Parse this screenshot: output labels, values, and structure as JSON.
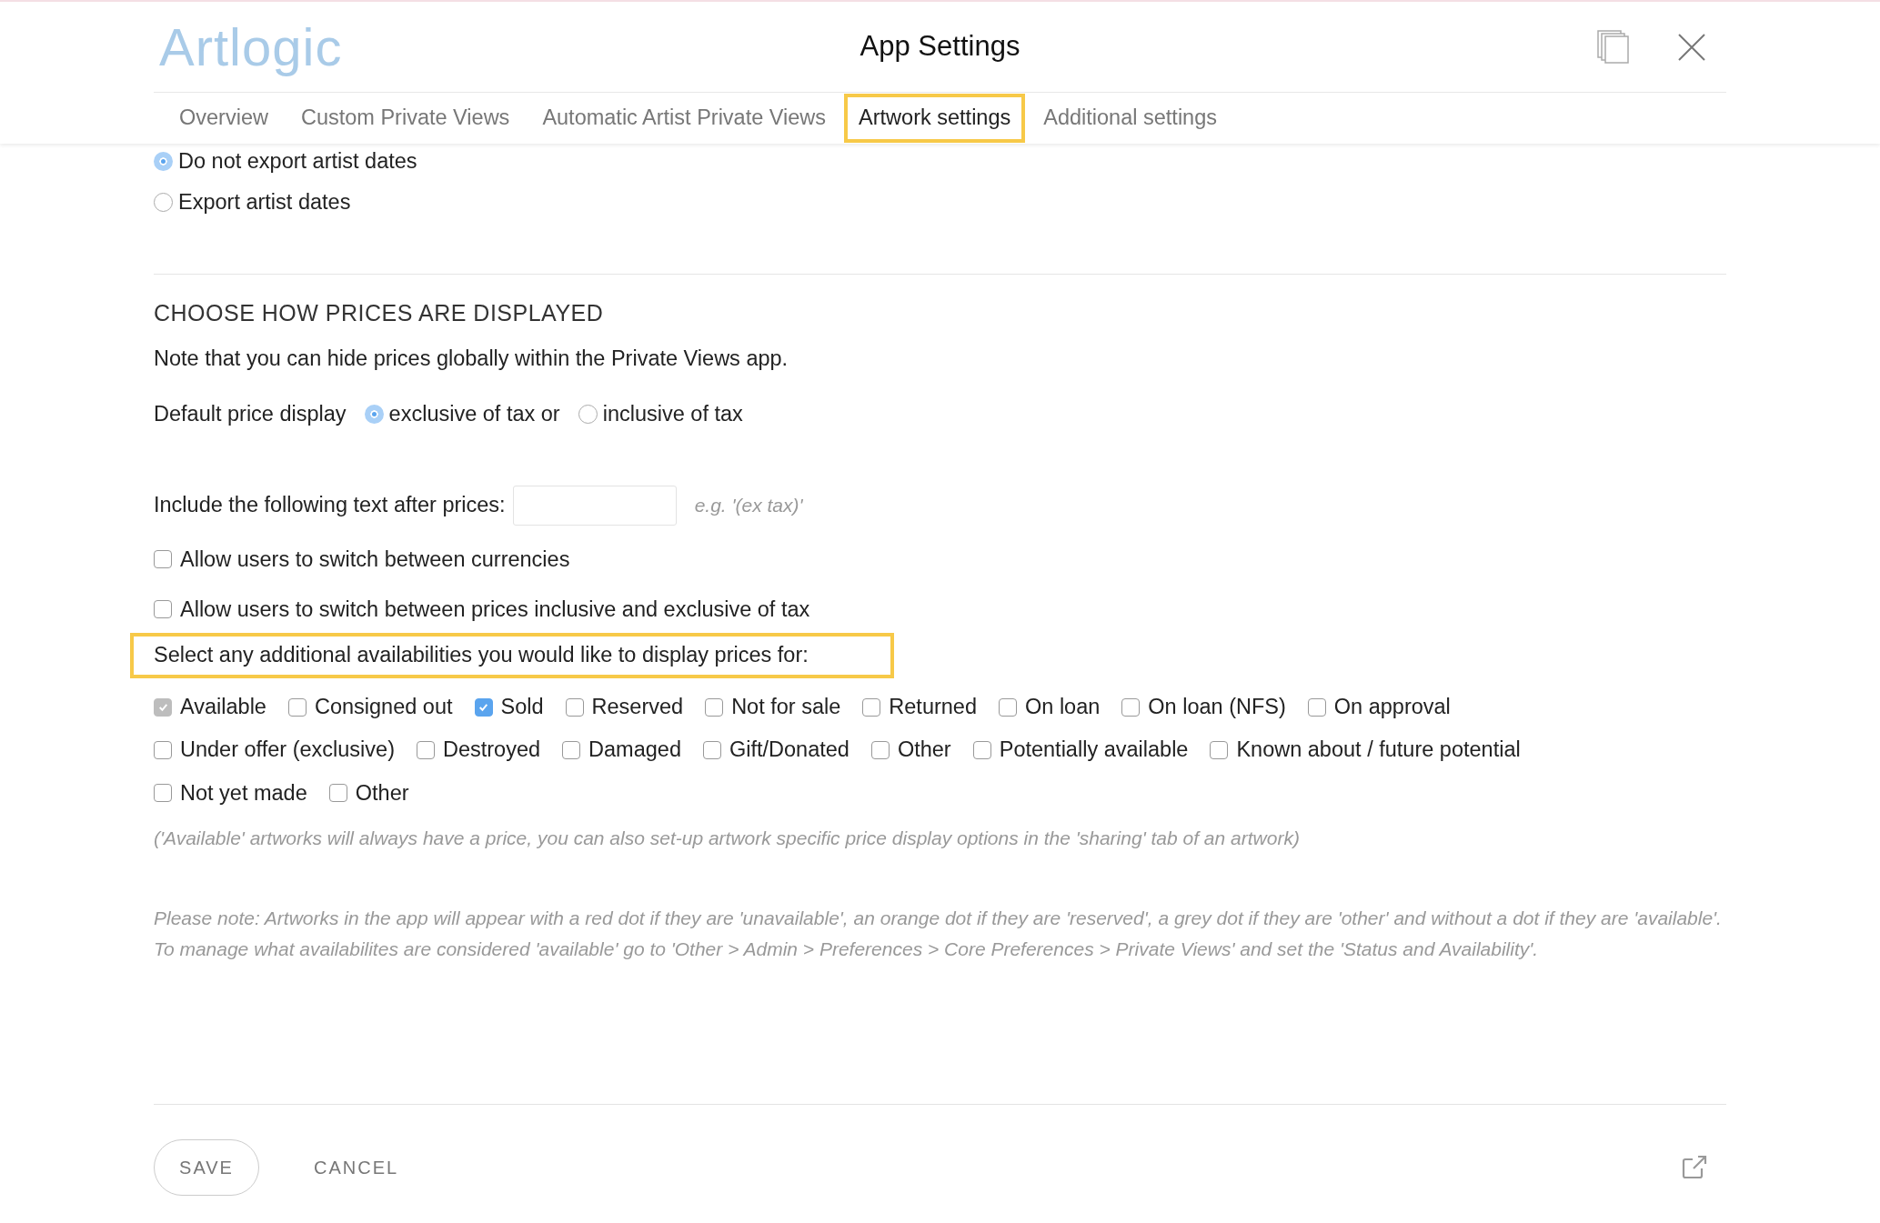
{
  "header": {
    "logo": "Artlogic",
    "title": "App Settings"
  },
  "tabs": [
    {
      "label": "Overview",
      "selected": false,
      "highlighted": false
    },
    {
      "label": "Custom Private Views",
      "selected": false,
      "highlighted": false
    },
    {
      "label": "Automatic Artist Private Views",
      "selected": false,
      "highlighted": false
    },
    {
      "label": "Artwork settings",
      "selected": true,
      "highlighted": true
    },
    {
      "label": "Additional settings",
      "selected": false,
      "highlighted": false
    }
  ],
  "artist_dates": [
    {
      "label": "Do not export artist dates",
      "selected": true
    },
    {
      "label": "Export artist dates",
      "selected": false
    }
  ],
  "prices": {
    "heading": "CHOOSE HOW PRICES ARE DISPLAYED",
    "note": "Note that you can hide prices globally within the Private Views app.",
    "default_label": "Default price display",
    "default_options": [
      {
        "label": "exclusive of tax or",
        "selected": true
      },
      {
        "label": "inclusive of tax",
        "selected": false
      }
    ],
    "text_after_label": "Include the following text after prices:",
    "text_after_hint": "e.g. '(ex tax)'",
    "switches": [
      {
        "label": "Allow users to switch between currencies",
        "checked": false
      },
      {
        "label": "Allow users to switch between prices inclusive and exclusive of tax",
        "checked": false
      }
    ],
    "availability_prompt": {
      "text": "Select any additional availabilities you would like to display prices for:",
      "highlighted": true
    },
    "availability_rows": [
      {
        "items": [
          {
            "label": "Available",
            "checked": true,
            "disabled": true
          },
          {
            "label": "Consigned out",
            "checked": false,
            "disabled": false
          },
          {
            "label": "Sold",
            "checked": true,
            "disabled": false
          },
          {
            "label": "Reserved",
            "checked": false,
            "disabled": false
          },
          {
            "label": "Not for sale",
            "checked": false,
            "disabled": false
          },
          {
            "label": "Returned",
            "checked": false,
            "disabled": false
          },
          {
            "label": "On loan",
            "checked": false,
            "disabled": false
          },
          {
            "label": "On loan (NFS)",
            "checked": false,
            "disabled": false
          },
          {
            "label": "On approval",
            "checked": false,
            "disabled": false
          }
        ]
      },
      {
        "items": [
          {
            "label": "Under offer (exclusive)",
            "checked": false,
            "disabled": false
          },
          {
            "label": "Destroyed",
            "checked": false,
            "disabled": false
          },
          {
            "label": "Damaged",
            "checked": false,
            "disabled": false
          },
          {
            "label": "Gift/Donated",
            "checked": false,
            "disabled": false
          },
          {
            "label": "Other",
            "checked": false,
            "disabled": false
          },
          {
            "label": "Potentially available",
            "checked": false,
            "disabled": false
          },
          {
            "label": "Known about / future potential",
            "checked": false,
            "disabled": false
          }
        ]
      },
      {
        "items": [
          {
            "label": "Not yet made",
            "checked": false,
            "disabled": false
          },
          {
            "label": "Other",
            "checked": false,
            "disabled": false
          }
        ]
      }
    ],
    "availability_hint": "('Available' artworks will always have a price, you can also set-up artwork specific price display options in the 'sharing' tab of an artwork)",
    "please_note": "Please note: Artworks in the app will appear with a red dot if they are 'unavailable', an orange dot if they are 'reserved', a grey dot if they are 'other' and without a dot if they are 'available'. To manage what availabilites are considered 'available' go to 'Other > Admin > Preferences > Core Preferences > Private Views' and set the 'Status and Availability'."
  },
  "footer": {
    "save": "SAVE",
    "cancel": "CANCEL"
  }
}
